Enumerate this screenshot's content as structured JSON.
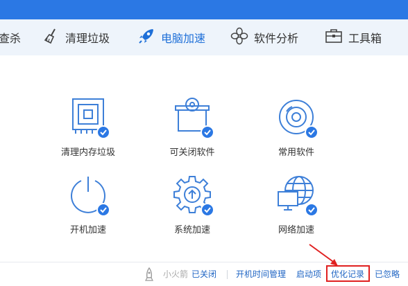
{
  "nav": {
    "items": [
      {
        "label": "查杀",
        "icon": "antivirus-icon"
      },
      {
        "label": "清理垃圾",
        "icon": "broom-icon"
      },
      {
        "label": "电脑加速",
        "icon": "rocket-icon"
      },
      {
        "label": "软件分析",
        "icon": "flower-icon"
      },
      {
        "label": "工具箱",
        "icon": "toolbox-icon"
      }
    ]
  },
  "grid": {
    "items": [
      {
        "label": "清理内存垃圾",
        "icon": "memory-chip-icon"
      },
      {
        "label": "可关闭软件",
        "icon": "software-box-icon"
      },
      {
        "label": "常用软件",
        "icon": "disc-icon"
      },
      {
        "label": "开机加速",
        "icon": "power-icon"
      },
      {
        "label": "系统加速",
        "icon": "gear-icon"
      },
      {
        "label": "网络加速",
        "icon": "globe-monitor-icon"
      }
    ]
  },
  "footer": {
    "rocket_label": "小火箭",
    "rocket_status": "已关闭",
    "boot_time": "开机时间管理",
    "startup": "启动项",
    "history": "优化记录",
    "ignored": "已忽略"
  },
  "colors": {
    "accent": "#2b78e4",
    "highlight": "#e02020",
    "link": "#2166c4"
  }
}
